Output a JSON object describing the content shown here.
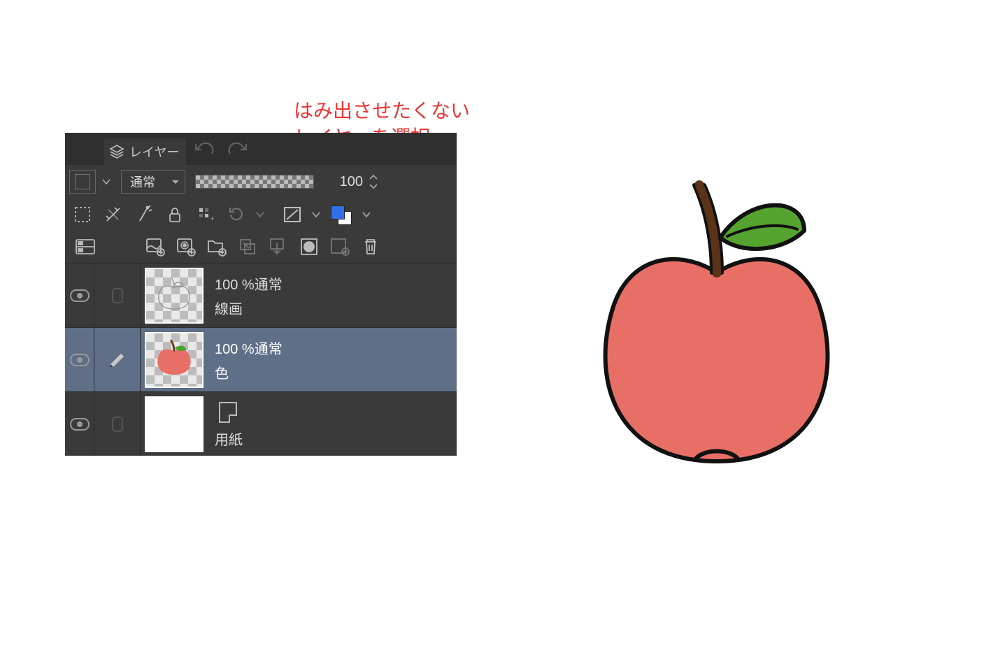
{
  "annotation": {
    "line1": "はみ出させたくない",
    "line2": "レイヤーを選択"
  },
  "header": {
    "tab_label": "レイヤー"
  },
  "blend": {
    "mode": "通常",
    "opacity": "100"
  },
  "layers": [
    {
      "opacity_label": "100 %通常",
      "name": "線画"
    },
    {
      "opacity_label": "100 %通常",
      "name": "色"
    },
    {
      "name": "用紙"
    }
  ],
  "icons": {
    "menu": "menu-icon",
    "layers": "layers-icon",
    "undo": "undo-icon",
    "redo": "redo-icon",
    "select_border": "select-border-icon",
    "ruler": "ruler-icon",
    "wand": "wand-icon",
    "lock": "lock-icon",
    "fx": "fx-icon",
    "refresh": "refresh-icon",
    "mask": "mask-icon",
    "palette": "palette-icon",
    "two_pane": "two-pane-icon",
    "new_layer": "new-layer-icon",
    "new_layer_fx": "new-layer-fx-icon",
    "new_folder": "new-folder-icon",
    "transfer": "transfer-icon",
    "merge": "merge-icon",
    "circle": "circle-mask-icon",
    "add_mask": "add-mask-icon",
    "trash": "trash-icon",
    "eye": "eye-icon",
    "pencil": "pencil-icon"
  }
}
